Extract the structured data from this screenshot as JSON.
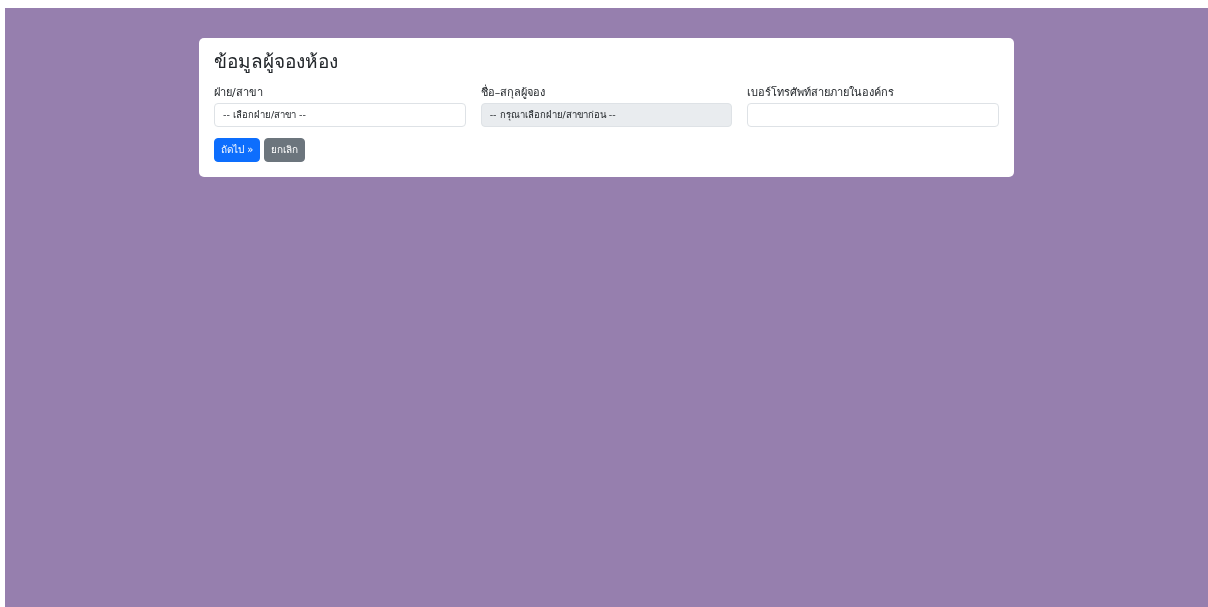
{
  "form": {
    "title": "ข้อมูลผู้จองห้อง",
    "fields": [
      {
        "kind": "select",
        "label": "ฝ่าย/สาขา",
        "value": "-- เลือกฝ่าย/สาขา --",
        "disabled": false
      },
      {
        "kind": "select",
        "label": "ชื่อ–สกุลผู้จอง",
        "value": "-- กรุณาเลือกฝ่าย/สาขาก่อน --",
        "disabled": true
      },
      {
        "kind": "text",
        "label": "เบอร์โทรศัพท์สายภายในองค์กร",
        "disabled": false
      }
    ],
    "buttons": [
      {
        "label": "ถัดไป »",
        "kind": "primary"
      },
      {
        "label": "ยกเลิก",
        "kind": "secondary"
      }
    ]
  }
}
